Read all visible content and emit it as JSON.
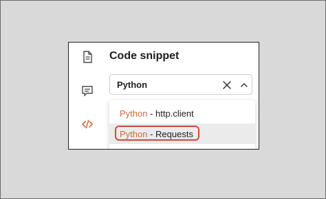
{
  "panel": {
    "title": "Code snippet"
  },
  "rail": {
    "icons": [
      "document-icon",
      "comment-icon",
      "code-icon"
    ]
  },
  "select": {
    "value": "Python"
  },
  "dropdown": {
    "options": [
      {
        "language": "Python",
        "separator": " - ",
        "library": "http.client"
      },
      {
        "language": "Python",
        "separator": " - ",
        "library": "Requests"
      }
    ]
  },
  "colors": {
    "accent": "#d26a3c",
    "highlight_border": "#d0483b",
    "selected_row": "#ebebeb"
  }
}
